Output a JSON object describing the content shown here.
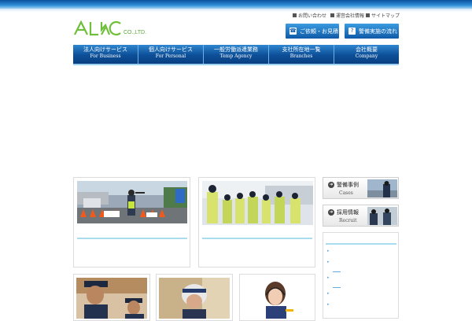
{
  "logo": {
    "text": "ALC",
    "suffix": "CO.,LTD."
  },
  "util_links": [
    "お問い合わせ",
    "運営会社情報",
    "サイトマップ"
  ],
  "top_buttons": [
    {
      "label": "ご依頼・お見積",
      "icon": "phone-icon"
    },
    {
      "label": "警備実施の流れ",
      "icon": "question-icon"
    }
  ],
  "nav": [
    {
      "ja": "法人向けサービス",
      "en": "For Business"
    },
    {
      "ja": "個人向けサービス",
      "en": "For Personal"
    },
    {
      "ja": "一般労働派遣業務",
      "en": "Temp Agency"
    },
    {
      "ja": "支社所在地一覧",
      "en": "Branches"
    },
    {
      "ja": "会社概要",
      "en": "Company"
    }
  ],
  "side": [
    {
      "ja": "警備事例",
      "en": "Cases"
    },
    {
      "ja": "採用情報",
      "en": "Recruit"
    }
  ],
  "colors": {
    "nav_dark": "#0a3f80",
    "nav_light": "#2f86d0",
    "accent": "#a9dcef"
  }
}
